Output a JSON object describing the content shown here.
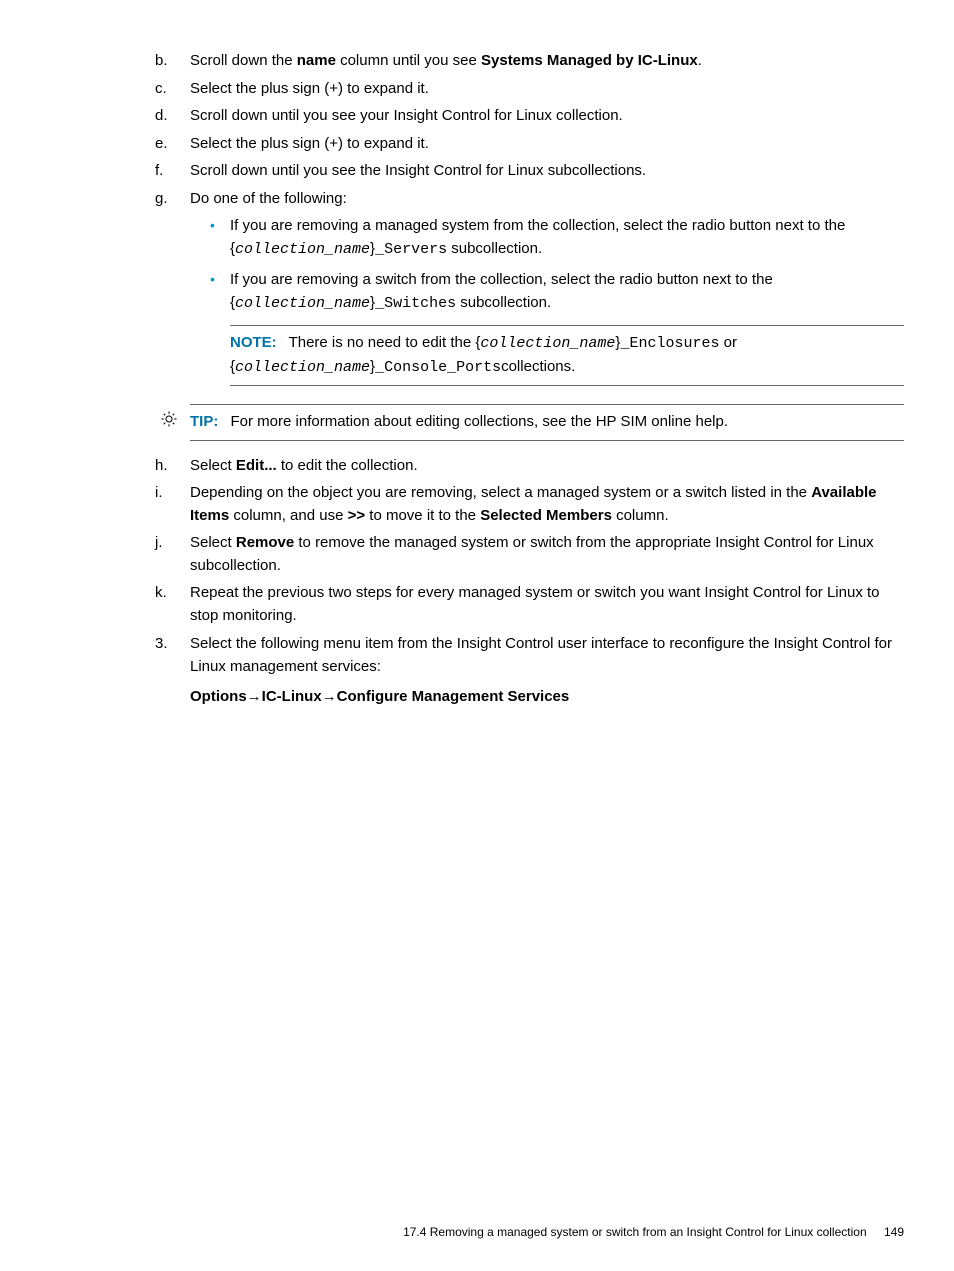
{
  "steps_alpha_1": {
    "b": {
      "marker": "b.",
      "pre": "Scroll down the ",
      "bold1": "name",
      "mid": " column until you see ",
      "bold2": "Systems Managed by IC-Linux",
      "post": "."
    },
    "c": {
      "marker": "c.",
      "text": "Select the plus sign (+) to expand it."
    },
    "d": {
      "marker": "d.",
      "text": "Scroll down until you see your Insight Control for Linux collection."
    },
    "e": {
      "marker": "e.",
      "text": "Select the plus sign (+) to expand it."
    },
    "f": {
      "marker": "f.",
      "text": "Scroll down until you see the Insight Control for Linux subcollections."
    },
    "g": {
      "marker": "g.",
      "text": "Do one of the following:",
      "bullets": {
        "0": {
          "pre": "If you are removing a managed system from the collection, select the radio button next to the {",
          "code": "collection_name",
          "mid": "}",
          "mono": "_Servers",
          "post": " subcollection."
        },
        "1": {
          "pre": "If you are removing a switch from the collection, select the radio button next to the {",
          "code": "collection_name",
          "mid": "}",
          "mono": "_Switches",
          "post": " subcollection."
        }
      }
    }
  },
  "note": {
    "label": "NOTE:",
    "pre": "There is no need to edit the {",
    "code1": "collection_name",
    "mid1": "}",
    "mono1": "_Enclosures",
    "or": " or {",
    "code2": "collection_name",
    "mid2": "}",
    "mono2": "_Console_Ports",
    "post": "collections."
  },
  "tip": {
    "label": "TIP:",
    "text": "For more information about editing collections, see the HP SIM online help."
  },
  "steps_alpha_2": {
    "h": {
      "marker": "h.",
      "pre": "Select ",
      "bold": "Edit...",
      "post": " to edit the collection."
    },
    "i": {
      "marker": "i.",
      "pre": "Depending on the object you are removing, select a managed system or a switch listed in the ",
      "bold1": "Available Items",
      "mid": " column, and use ",
      "bold2": ">>",
      "mid2": " to move it to the ",
      "bold3": "Selected Members",
      "post": " column."
    },
    "j": {
      "marker": "j.",
      "pre": "Select ",
      "bold": "Remove",
      "post": " to remove the managed system or switch from the appropriate Insight Control for Linux subcollection."
    },
    "k": {
      "marker": "k.",
      "text": "Repeat the previous two steps for every managed system or switch you want Insight Control for Linux to stop monitoring."
    }
  },
  "numbered": {
    "3": {
      "marker": "3.",
      "text": "Select the following menu item from the Insight Control user interface to reconfigure the Insight Control for Linux management services:",
      "menu": {
        "s1": "Options",
        "arr1": "→",
        "s2": "IC-Linux",
        "arr2": "→",
        "s3": "Configure Management Services"
      }
    }
  },
  "footer": {
    "section": "17.4 Removing a managed system or switch from an Insight Control for Linux collection",
    "page": "149"
  }
}
